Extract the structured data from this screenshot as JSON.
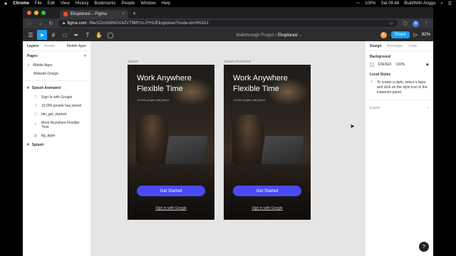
{
  "menubar": {
    "apple": "",
    "app": "Chrome",
    "menus": [
      "File",
      "Edit",
      "View",
      "History",
      "Bookmarks",
      "People",
      "Window",
      "Help"
    ],
    "battery": "100%",
    "clock": "Sat 09.48",
    "user": "BuildWith Angga"
  },
  "browser": {
    "tab_title": "Eksplorasi – Figma",
    "tab_close": "×",
    "new_tab": "+",
    "url_host": "figma.com",
    "url_path": "/file/1DmfxBNGX4ZV79MYzcJYHz/Eksplorasi?node-id=0%3A1",
    "profile": "A"
  },
  "figma": {
    "breadcrumb_project": "Walkthrough Project",
    "breadcrumb_sep": "/",
    "file_name": "Eksplorasi",
    "avatar_letter": "B",
    "share_label": "Share",
    "zoom": "82%"
  },
  "layers_panel": {
    "tab_layers": "Layers",
    "tab_assets": "Assets",
    "page_select": "Mobile Apps",
    "pages_label": "Pages",
    "add": "+",
    "pages": [
      "Mobile Apps",
      "Website Design"
    ],
    "frame_splash_animated": "Splash Animated",
    "children": [
      {
        "glyph": "T",
        "label": "Sign In with Google"
      },
      {
        "glyph": "T",
        "label": "15,000 people has joined"
      },
      {
        "glyph": "▢",
        "label": "btn_get_started"
      },
      {
        "glyph": "T",
        "label": "Work Anywhere Flexible Time"
      },
      {
        "glyph": "▨",
        "label": "bg_apps"
      }
    ],
    "frame_splash": "Splash"
  },
  "canvas": {
    "frames": [
      {
        "label": "Splash"
      },
      {
        "label": "Splash Animated"
      }
    ],
    "headline_line1": "Work Anywhere",
    "headline_line2": "Flexible Time",
    "subtext": "15,000 people has joined",
    "cta": "Get Started",
    "signin": "Sign In with Google"
  },
  "design_panel": {
    "tab_design": "Design",
    "tab_prototype": "Prototype",
    "tab_code": "Code",
    "background_label": "Background",
    "bg_hex": "E5E5E5",
    "bg_opacity": "100%",
    "local_styles_label": "Local Styles",
    "local_styles_hint": "To create a style, select a layer and click on the style icon in the inspector panel.",
    "export_label": "Export",
    "export_add": "+"
  },
  "help": "?",
  "colors": {
    "figma_blue": "#18a0fb",
    "cta_purple": "#4a4af4",
    "canvas_bg": "#e5e5e5"
  }
}
